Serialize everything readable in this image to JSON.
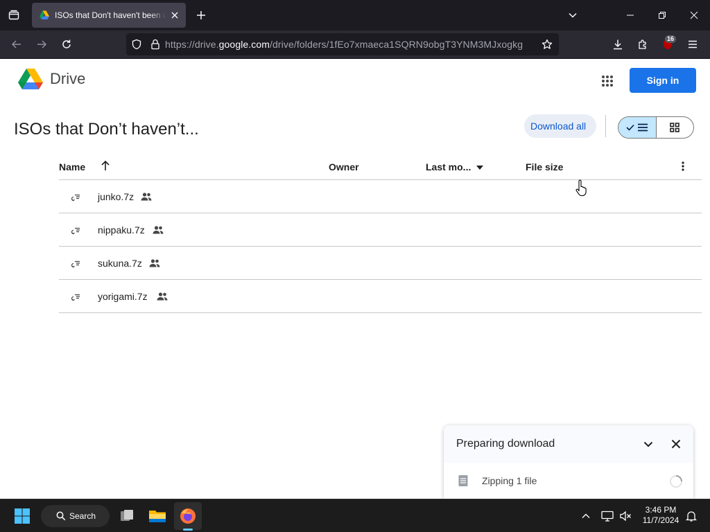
{
  "browser": {
    "tab_title": "ISOs that Don't haven't been up",
    "url_prefix": "https://drive.",
    "url_domain": "google.com",
    "url_path": "/drive/folders/1fEo7xmaeca1SQRN9obgT3YNM3MJxogkg",
    "extension_badge": "16"
  },
  "drive": {
    "brand": "Drive",
    "sign_in": "Sign in",
    "folder_title": "ISOs that Don’t haven’t...",
    "download_all": "Download all",
    "columns": {
      "name": "Name",
      "owner": "Owner",
      "last_modified": "Last mo...",
      "file_size": "File size"
    },
    "files": [
      {
        "name": "junko.7z"
      },
      {
        "name": "nippaku.7z"
      },
      {
        "name": "sukuna.7z"
      },
      {
        "name": "yorigami.7z"
      }
    ]
  },
  "download_panel": {
    "title": "Preparing download",
    "status": "Zipping 1 file"
  },
  "taskbar": {
    "search_label": "Search",
    "time": "3:46 PM",
    "date": "11/7/2024"
  },
  "colors": {
    "brand_blue": "#1a73e8",
    "link_blue": "#0b57d0",
    "selected_toggle": "#c2e7ff"
  }
}
